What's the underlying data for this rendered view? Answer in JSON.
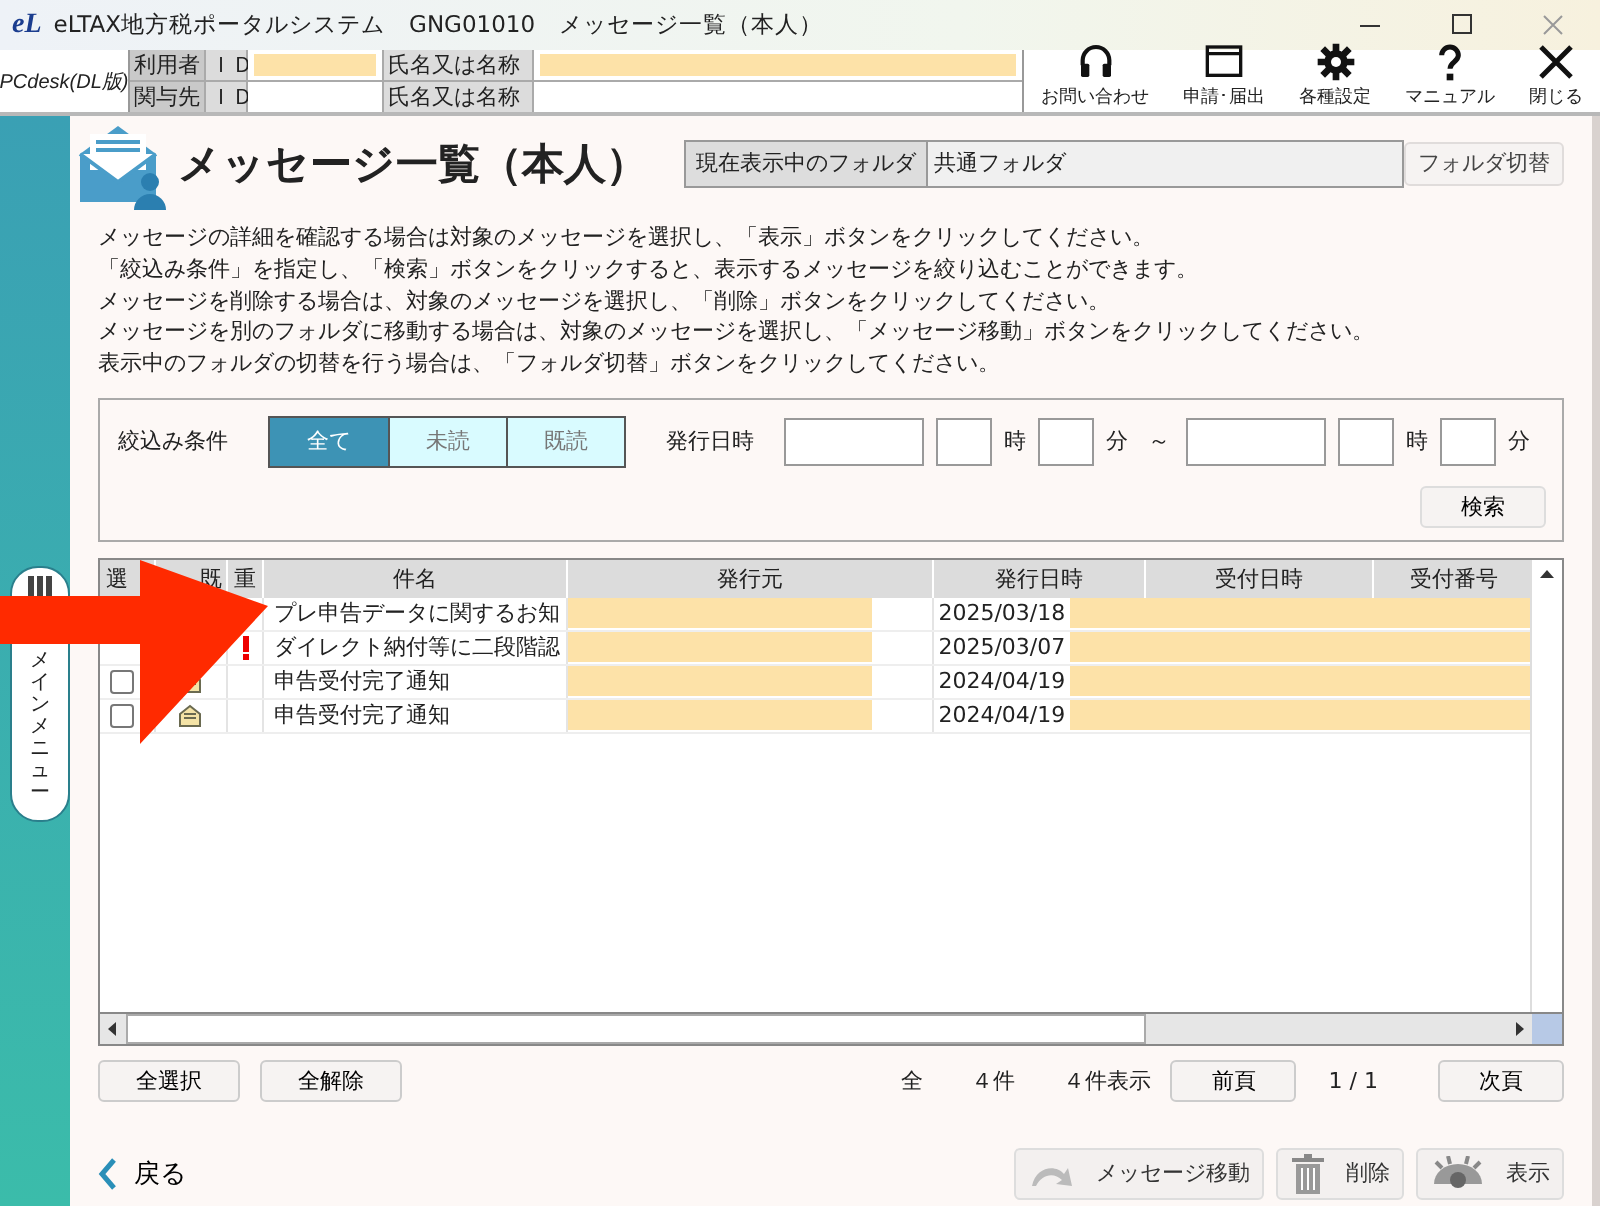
{
  "window": {
    "app_logo": "eL",
    "title": "eLTAX地方税ポータルシステム　GNG01010　メッセージ一覧（本人）"
  },
  "header": {
    "brand": "PCdesk(DL版)",
    "user_rows": [
      {
        "role": "利用者",
        "id_label": "ＩＤ",
        "name_label": "氏名又は名称",
        "redacted": true
      },
      {
        "role": "関与先",
        "id_label": "ＩＤ",
        "name_label": "氏名又は名称",
        "redacted": false
      }
    ],
    "toolbar": [
      {
        "label": "お問い合わせ",
        "kind": "headset"
      },
      {
        "label": "申請･届出",
        "kind": "window"
      },
      {
        "label": "各種設定",
        "kind": "gear"
      },
      {
        "label": "マニュアル",
        "kind": "help"
      },
      {
        "label": "閉じる",
        "kind": "close"
      }
    ]
  },
  "side_tab": "メインメニュー",
  "page": {
    "title": "メッセージ一覧（本人）",
    "folder_label": "現在表示中のフォルダ",
    "folder_value": "共通フォルダ",
    "folder_button": "フォルダ切替"
  },
  "instructions": [
    "メッセージの詳細を確認する場合は対象のメッセージを選択し、「表示」ボタンをクリックしてください。",
    "「絞込み条件」を指定し、「検索」ボタンをクリックすると、表示するメッセージを絞り込むことができます。",
    "メッセージを削除する場合は、対象のメッセージを選択し、「削除」ボタンをクリックしてください。",
    "メッセージを別のフォルダに移動する場合は、対象のメッセージを選択し、「メッセージ移動」ボタンをクリックしてください。",
    "表示中のフォルダの切替を行う場合は、「フォルダ切替」ボタンをクリックしてください。"
  ],
  "filter": {
    "label": "絞込み条件",
    "options": [
      {
        "label": "全て",
        "selected": true
      },
      {
        "label": "未読",
        "selected": false
      },
      {
        "label": "既読",
        "selected": false
      }
    ],
    "date_label": "発行日時",
    "from": {
      "hour_unit": "時",
      "minute_unit": "分"
    },
    "range_separator": "～",
    "to": {
      "hour_unit": "時",
      "minute_unit": "分"
    },
    "search_button": "検索"
  },
  "table": {
    "columns": [
      "選",
      "既",
      "重",
      "件名",
      "発行元",
      "発行日時",
      "受付日時",
      "受付番号"
    ],
    "rows": [
      {
        "urgent": false,
        "subject": "プレ申告データに関するお知",
        "issue_date": "2025/03/18",
        "redacted": true
      },
      {
        "urgent": true,
        "subject": "ダイレクト納付等に二段階認",
        "issue_date": "2025/03/07",
        "redacted": true
      },
      {
        "checked": false,
        "read": true,
        "urgent": false,
        "subject": "申告受付完了通知",
        "issue_date": "2024/04/19",
        "redacted": true
      },
      {
        "checked": false,
        "read": true,
        "urgent": false,
        "subject": "申告受付完了通知",
        "issue_date": "2024/04/19",
        "redacted": true
      }
    ]
  },
  "pager": {
    "select_all": "全選択",
    "clear_all": "全解除",
    "total_label": "全",
    "total": "４件",
    "shown": "４件表示",
    "prev": "前頁",
    "page": "1 / 1",
    "next": "次頁"
  },
  "footer": {
    "back": "戻る",
    "actions": [
      {
        "label": "メッセージ移動",
        "kind": "move"
      },
      {
        "label": "削除",
        "kind": "delete"
      },
      {
        "label": "表示",
        "kind": "view"
      }
    ]
  },
  "overlays": [
    {
      "kind": "arrow"
    }
  ]
}
